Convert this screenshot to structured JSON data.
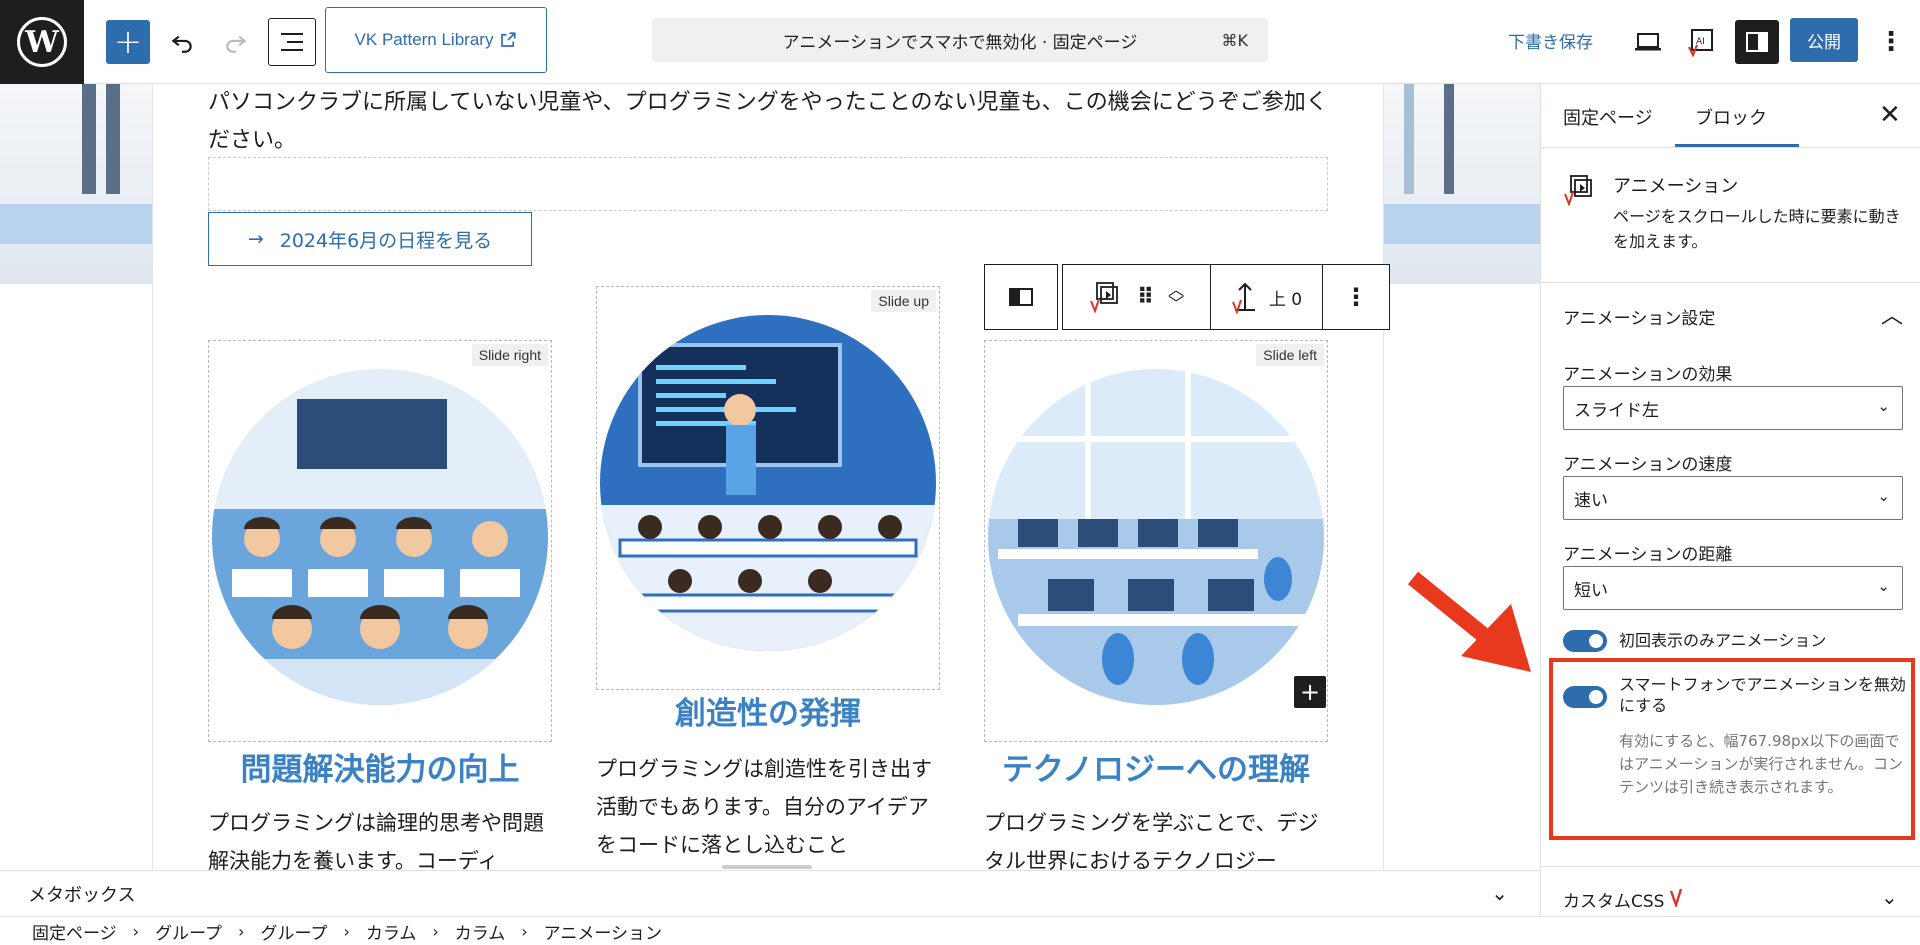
{
  "topbar": {
    "vk_library_label": "VK Pattern Library",
    "command_title": "アニメーションでスマホで無効化 · 固定ページ",
    "command_shortcut": "⌘K",
    "save_draft_label": "下書き保存",
    "publish_label": "公開",
    "colors": {
      "accent": "#2e6dad",
      "dark": "#1e1e1e"
    }
  },
  "canvas": {
    "intro_text": "パソコンクラブに所属していない児童や、プログラミングをやったことのない児童も、この機会にどうぞご参加ください。",
    "schedule_button_label": "2024年6月の日程を見る",
    "columns": [
      {
        "badge": "Slide right",
        "title": "問題解決能力の向上",
        "body": "プログラミングは論理的思考や問題解決能力を養います。コーディ"
      },
      {
        "badge": "Slide up",
        "title": "創造性の発揮",
        "body": "プログラミングは創造性を引き出す活動でもあります。自分のアイデアをコードに落とし込むこと"
      },
      {
        "badge": "Slide left",
        "title": "テクノロジーへの理解",
        "body": "プログラミングを学ぶことで、デジタル世界におけるテクノロジー"
      }
    ],
    "block_toolbar": {
      "position_label": "上 0"
    }
  },
  "metabox": {
    "label": "メタボックス"
  },
  "breadcrumb": [
    "固定ページ",
    "グループ",
    "グループ",
    "カラム",
    "カラム",
    "アニメーション"
  ],
  "sidebar": {
    "tabs": [
      "固定ページ",
      "ブロック"
    ],
    "active_tab": "ブロック",
    "block_title": "アニメーション",
    "block_description": "ページをスクロールした時に要素に動きを加えます。",
    "panel_title": "アニメーション設定",
    "fields": [
      {
        "label": "アニメーションの効果",
        "value": "スライド左"
      },
      {
        "label": "アニメーションの速度",
        "value": "速い"
      },
      {
        "label": "アニメーションの距離",
        "value": "短い"
      }
    ],
    "toggles": [
      {
        "label": "初回表示のみアニメーション",
        "checked": true
      },
      {
        "label": "スマートフォンでアニメーションを無効にする",
        "checked": true,
        "help": "有効にすると、幅767.98px以下の画面ではアニメーションが実行されません。コンテンツは引き続き表示されます。"
      }
    ],
    "custom_css_label": "カスタムCSS",
    "highlight_color": "#e8391f"
  }
}
